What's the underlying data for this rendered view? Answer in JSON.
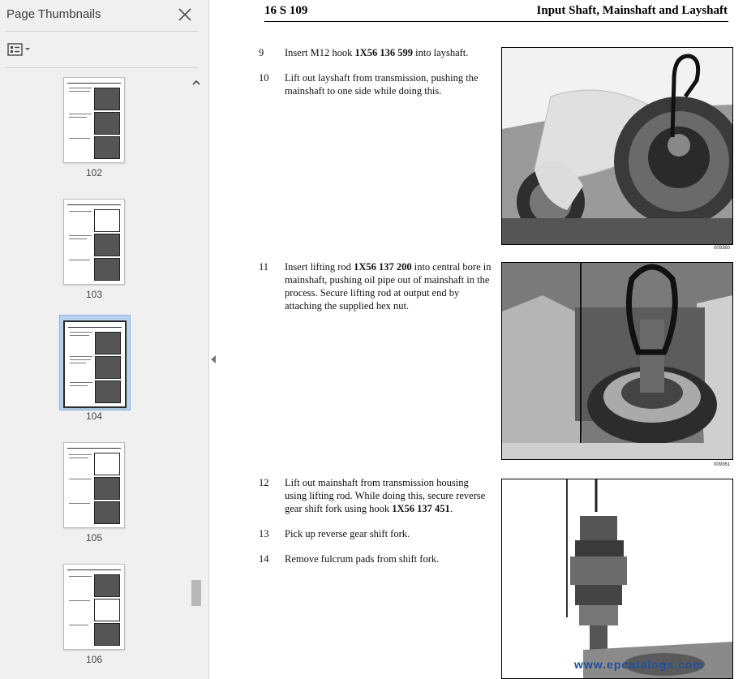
{
  "sidebar": {
    "title": "Page Thumbnails",
    "thumbnails": [
      {
        "label": "102"
      },
      {
        "label": "103"
      },
      {
        "label": "104",
        "selected": true
      },
      {
        "label": "105"
      },
      {
        "label": "106"
      }
    ]
  },
  "document": {
    "header_left": "16 S 109",
    "header_right": "Input Shaft, Mainshaft and Layshaft",
    "steps": [
      {
        "num": "9",
        "pre": "Insert M12 hook ",
        "bold": "1X56 136 599",
        "post": " into layshaft."
      },
      {
        "num": "10",
        "pre": "Lift out layshaft from transmission, pushing the mainshaft to one side while doing this.",
        "bold": "",
        "post": ""
      },
      {
        "num": "11",
        "pre": "Insert lifting rod ",
        "bold": "1X56 137 200",
        "post": " into central bore in mainshaft, pushing oil pipe out of mainshaft in the process. Secure lifting rod at output end by attaching the supplied hex nut."
      },
      {
        "num": "12",
        "pre": "Lift out mainshaft from transmission housing using lifting rod. While doing this, secure reverse gear shift fork using hook ",
        "bold": "1X56 137 451",
        "post": "."
      },
      {
        "num": "13",
        "pre": "Pick up reverse gear shift fork.",
        "bold": "",
        "post": ""
      },
      {
        "num": "14",
        "pre": "Remove fulcrum pads from shift fork.",
        "bold": "",
        "post": ""
      }
    ],
    "figures": [
      {
        "caption": "009360"
      },
      {
        "caption": "009361"
      },
      {
        "caption": ""
      }
    ],
    "watermark": "www.epcatalogs.com"
  }
}
